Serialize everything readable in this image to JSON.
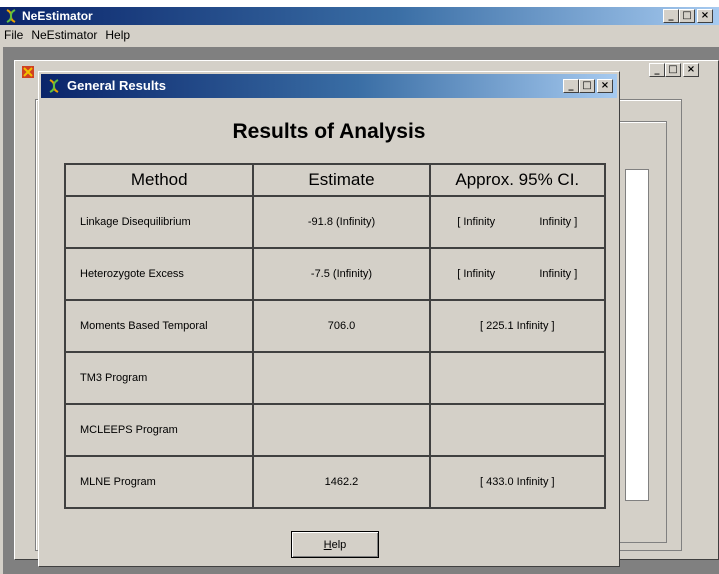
{
  "app": {
    "title": "NeEstimator",
    "menu": [
      "File",
      "NeEstimator",
      "Help"
    ]
  },
  "window_buttons": {
    "minimize": "_",
    "maximize": "□",
    "close": "×"
  },
  "dialog": {
    "title": "General Results",
    "heading": "Results of Analysis",
    "columns": [
      "Method",
      "Estimate",
      "Approx. 95% CI."
    ],
    "rows": [
      {
        "method": "Linkage Disequilibrium",
        "estimate": "-91.8 (Infinity)",
        "ci_low": "[ Infinity",
        "ci_high": "Infinity ]"
      },
      {
        "method": "Heterozygote Excess",
        "estimate": "-7.5 (Infinity)",
        "ci_low": "[ Infinity",
        "ci_high": "Infinity ]"
      },
      {
        "method": "Moments Based Temporal",
        "estimate": "706.0",
        "ci": "[ 225.1 Infinity ]"
      },
      {
        "method": "TM3 Program",
        "estimate": "",
        "ci": ""
      },
      {
        "method": "MCLEEPS Program",
        "estimate": "",
        "ci": ""
      },
      {
        "method": "MLNE Program",
        "estimate": "1462.2",
        "ci": "[ 433.0 Infinity ]"
      }
    ],
    "help_button": {
      "prefix": "H",
      "rest": "elp"
    }
  }
}
